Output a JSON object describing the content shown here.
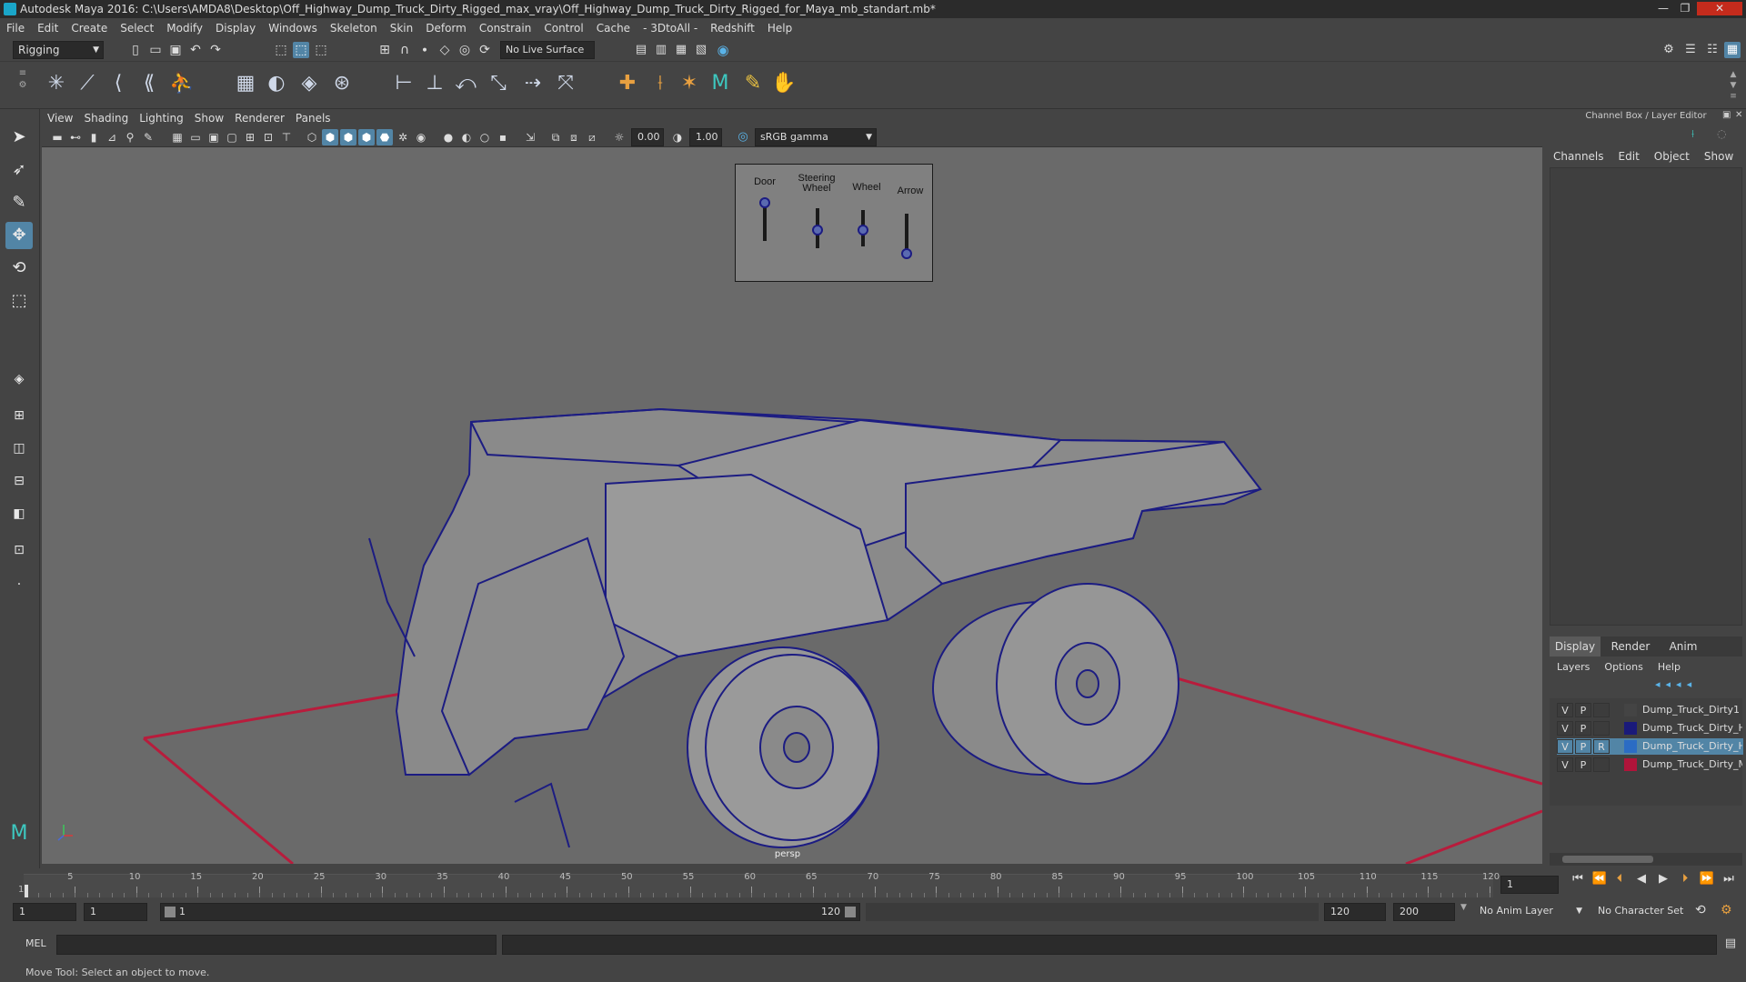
{
  "window": {
    "title": "Autodesk Maya 2016: C:\\Users\\AMDA8\\Desktop\\Off_Highway_Dump_Truck_Dirty_Rigged_max_vray\\Off_Highway_Dump_Truck_Dirty_Rigged_for_Maya_mb_standart.mb*",
    "minimize": "—",
    "restore": "❐",
    "close": "✕"
  },
  "menubar": [
    "File",
    "Edit",
    "Create",
    "Select",
    "Modify",
    "Display",
    "Windows",
    "Skeleton",
    "Skin",
    "Deform",
    "Constrain",
    "Control",
    "Cache",
    "- 3DtoAll -",
    "Redshift",
    "Help"
  ],
  "status": {
    "mode": "Rigging",
    "live_surface": "No Live Surface"
  },
  "viewport": {
    "menu": [
      "View",
      "Shading",
      "Lighting",
      "Show",
      "Renderer",
      "Panels"
    ],
    "exposure": "0.00",
    "gamma": "1.00",
    "color_space": "sRGB gamma",
    "camera_label": "persp",
    "controls": [
      {
        "label": "Door",
        "value": 0.95
      },
      {
        "label": "Steering\nWheel",
        "value": 0.45
      },
      {
        "label": "Wheel",
        "value": 0.45
      },
      {
        "label": "Arrow",
        "value": 0.0
      }
    ]
  },
  "channelbox": {
    "title": "Channel Box / Layer Editor",
    "menu": [
      "Channels",
      "Edit",
      "Object",
      "Show"
    ],
    "tabs": [
      "Display",
      "Render",
      "Anim"
    ],
    "layer_menu": [
      "Layers",
      "Options",
      "Help"
    ],
    "layers": [
      {
        "v": "V",
        "p": "P",
        "r": "",
        "name": "Dump_Truck_Dirty1",
        "color": "#444444",
        "selected": false
      },
      {
        "v": "V",
        "p": "P",
        "r": "",
        "name": "Dump_Truck_Dirty_Hel",
        "color": "#1a1a7a",
        "selected": false
      },
      {
        "v": "V",
        "p": "P",
        "r": "R",
        "name": "Dump_Truck_Dirty_Hel",
        "color": "#2b6cc4",
        "selected": true
      },
      {
        "v": "V",
        "p": "P",
        "r": "",
        "name": "Dump_Truck_Dirty_Mai",
        "color": "#b0143a",
        "selected": false
      }
    ]
  },
  "timeline": {
    "ticks": [
      "1",
      "5",
      "10",
      "15",
      "20",
      "25",
      "30",
      "35",
      "40",
      "45",
      "50",
      "55",
      "60",
      "65",
      "70",
      "75",
      "80",
      "85",
      "90",
      "95",
      "100",
      "105",
      "110",
      "115",
      "120"
    ],
    "current_frame": "1"
  },
  "range": {
    "start": "1",
    "playback_start": "1",
    "slider_start": "1",
    "slider_end": "120",
    "playback_end": "120",
    "end": "200",
    "anim_layer": "No Anim Layer",
    "character_set": "No Character Set"
  },
  "cmdline": {
    "label": "MEL"
  },
  "helpline": {
    "text": "Move Tool: Select an object to move."
  }
}
